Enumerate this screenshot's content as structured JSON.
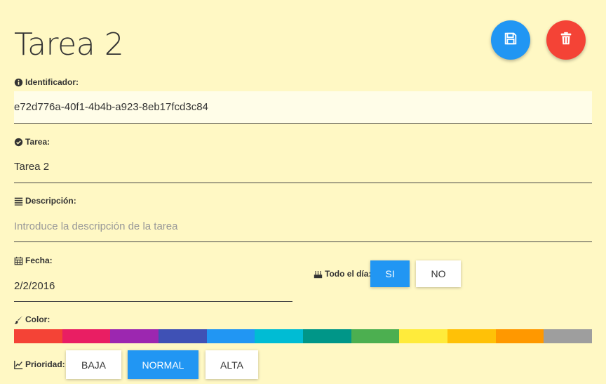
{
  "page": {
    "title": "Tarea 2",
    "save_icon": "floppy-disk-icon",
    "delete_icon": "trash-icon",
    "save_color": "#2196f3",
    "delete_color": "#f44336"
  },
  "fields": {
    "id": {
      "label": "Identificador:",
      "icon": "info-circle-icon",
      "value": "e72d776a-40f1-4b4b-a923-8eb17fcd3c84"
    },
    "task": {
      "label": "Tarea:",
      "icon": "check-circle-icon",
      "value": "Tarea 2"
    },
    "description": {
      "label": "Descripción:",
      "icon": "align-justify-icon",
      "value": "",
      "placeholder": "Introduce la descripción de la tarea"
    },
    "date": {
      "label": "Fecha:",
      "icon": "calendar-icon",
      "value": "2/2/2016"
    },
    "all_day": {
      "label": "Todo el día:",
      "icon": "birthday-cake-icon",
      "options": [
        "SI",
        "NO"
      ],
      "selected": "SI"
    },
    "color": {
      "label": "Color:",
      "icon": "paint-brush-icon",
      "swatches": [
        "#f44336",
        "#e91e63",
        "#9c27b0",
        "#3f51b5",
        "#2196f3",
        "#00bcd4",
        "#009688",
        "#4caf50",
        "#ffeb3b",
        "#ffc107",
        "#ff9800",
        "#9e9e9e"
      ]
    },
    "priority": {
      "label": "Prioridad:",
      "icon": "line-chart-icon",
      "options": [
        "BAJA",
        "NORMAL",
        "ALTA"
      ],
      "selected": "NORMAL"
    }
  },
  "colors": {
    "background": "#fff8c4",
    "accent": "#2196f3",
    "danger": "#f44336"
  }
}
